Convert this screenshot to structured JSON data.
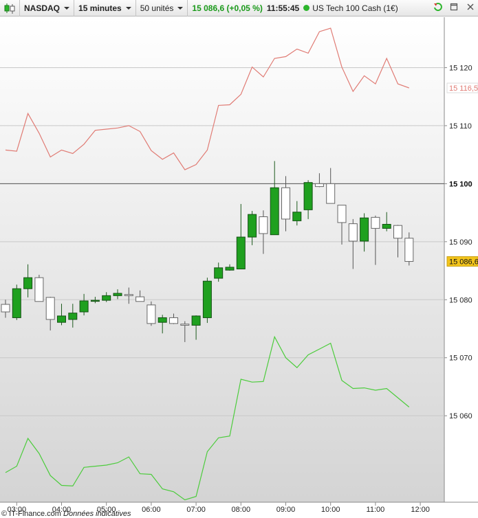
{
  "toolbar": {
    "symbol": "NASDAQ",
    "timeframe": "15 minutes",
    "units": "50 unités",
    "last_price": "15 086,6 (+0,05 %)",
    "time": "11:55:45",
    "instrument_name": "US Tech 100 Cash (1€)",
    "logo_icon": "candlestick-chart-icon",
    "refresh_icon": "refresh-icon",
    "restore_icon": "restore-window-icon",
    "close_icon": "close-icon"
  },
  "watermark": {
    "brand": "© IT-Finance.com",
    "note": "Données indicatives"
  },
  "colors": {
    "bull": "#1fa01f",
    "bear": "#ffffff",
    "upper_band": "#e07b74",
    "lower_band": "#4ccc3c",
    "last_price_bg": "#f2c41c",
    "last_upper_label": "#e07b74"
  },
  "chart_data": {
    "type": "candlestick",
    "x_tick_labels": [
      "03:00",
      "04:00",
      "05:00",
      "06:00",
      "07:00",
      "08:00",
      "09:00",
      "10:00",
      "11:00",
      "12:00"
    ],
    "y_tick_labels": [
      "15 120",
      "15 110",
      "15 100",
      "15 090",
      "15 080",
      "15 070",
      "15 060"
    ],
    "y_ticks": [
      15120,
      15110,
      15100,
      15090,
      15080,
      15070,
      15060
    ],
    "ylim": [
      15045.1,
      15128.7
    ],
    "reference_line": 15100,
    "reference_label": "15 100",
    "last_price": 15086.6,
    "last_price_label": "15 086,6",
    "upper_last": 15116.5,
    "upper_last_label": "15 116,5",
    "grid": true,
    "candles": [
      {
        "time": "02:45",
        "open": 15079.2,
        "high": 15080.0,
        "low": 15076.9,
        "close": 15077.9
      },
      {
        "time": "03:00",
        "open": 15076.9,
        "high": 15082.6,
        "low": 15076.5,
        "close": 15081.9
      },
      {
        "time": "03:15",
        "open": 15081.9,
        "high": 15086.1,
        "low": 15080.4,
        "close": 15083.8
      },
      {
        "time": "03:30",
        "open": 15083.8,
        "high": 15084.3,
        "low": 15079.7,
        "close": 15079.7
      },
      {
        "time": "03:45",
        "open": 15080.4,
        "high": 15080.5,
        "low": 15074.7,
        "close": 15076.6
      },
      {
        "time": "04:00",
        "open": 15076.1,
        "high": 15079.3,
        "low": 15075.6,
        "close": 15077.2
      },
      {
        "time": "04:15",
        "open": 15076.6,
        "high": 15079.3,
        "low": 15075.2,
        "close": 15077.7
      },
      {
        "time": "04:30",
        "open": 15077.9,
        "high": 15081.0,
        "low": 15077.3,
        "close": 15079.8
      },
      {
        "time": "04:45",
        "open": 15079.8,
        "high": 15080.5,
        "low": 15079.4,
        "close": 15079.9
      },
      {
        "time": "05:00",
        "open": 15079.9,
        "high": 15081.3,
        "low": 15079.6,
        "close": 15080.7
      },
      {
        "time": "05:15",
        "open": 15080.7,
        "high": 15081.8,
        "low": 15080.1,
        "close": 15081.1
      },
      {
        "time": "05:30",
        "open": 15080.9,
        "high": 15082.1,
        "low": 15079.3,
        "close": 15080.7
      },
      {
        "time": "05:45",
        "open": 15080.5,
        "high": 15081.6,
        "low": 15079.7,
        "close": 15079.7
      },
      {
        "time": "06:00",
        "open": 15079.1,
        "high": 15079.7,
        "low": 15075.5,
        "close": 15075.9
      },
      {
        "time": "06:15",
        "open": 15076.1,
        "high": 15077.4,
        "low": 15074.2,
        "close": 15076.9
      },
      {
        "time": "06:30",
        "open": 15076.9,
        "high": 15077.6,
        "low": 15075.8,
        "close": 15075.9
      },
      {
        "time": "06:45",
        "open": 15075.8,
        "high": 15076.3,
        "low": 15072.7,
        "close": 15075.6
      },
      {
        "time": "07:00",
        "open": 15075.6,
        "high": 15077.3,
        "low": 15073.1,
        "close": 15077.2
      },
      {
        "time": "07:15",
        "open": 15076.9,
        "high": 15083.8,
        "low": 15076.0,
        "close": 15083.2
      },
      {
        "time": "07:30",
        "open": 15083.7,
        "high": 15086.4,
        "low": 15083.1,
        "close": 15085.5
      },
      {
        "time": "07:45",
        "open": 15085.1,
        "high": 15086.1,
        "low": 15085.0,
        "close": 15085.6
      },
      {
        "time": "08:00",
        "open": 15085.3,
        "high": 15096.5,
        "low": 15085.3,
        "close": 15090.8
      },
      {
        "time": "08:15",
        "open": 15090.8,
        "high": 15095.3,
        "low": 15089.4,
        "close": 15094.7
      },
      {
        "time": "08:30",
        "open": 15094.3,
        "high": 15095.4,
        "low": 15087.9,
        "close": 15091.4
      },
      {
        "time": "08:45",
        "open": 15091.2,
        "high": 15103.9,
        "low": 15091.2,
        "close": 15099.3
      },
      {
        "time": "09:00",
        "open": 15099.3,
        "high": 15101.3,
        "low": 15091.8,
        "close": 15093.9
      },
      {
        "time": "09:15",
        "open": 15093.6,
        "high": 15097.0,
        "low": 15092.8,
        "close": 15095.1
      },
      {
        "time": "09:30",
        "open": 15095.5,
        "high": 15100.6,
        "low": 15093.9,
        "close": 15100.2
      },
      {
        "time": "09:45",
        "open": 15100.0,
        "high": 15101.8,
        "low": 15099.4,
        "close": 15099.5
      },
      {
        "time": "10:00",
        "open": 15100.0,
        "high": 15102.7,
        "low": 15098.7,
        "close": 15096.6
      },
      {
        "time": "10:15",
        "open": 15096.3,
        "high": 15096.3,
        "low": 15089.5,
        "close": 15093.3
      },
      {
        "time": "10:30",
        "open": 15093.1,
        "high": 15093.9,
        "low": 15085.3,
        "close": 15090.1
      },
      {
        "time": "10:45",
        "open": 15090.1,
        "high": 15094.9,
        "low": 15088.3,
        "close": 15094.1
      },
      {
        "time": "11:00",
        "open": 15094.2,
        "high": 15094.5,
        "low": 15086.0,
        "close": 15092.3
      },
      {
        "time": "11:15",
        "open": 15092.3,
        "high": 15095.1,
        "low": 15091.8,
        "close": 15093.0
      },
      {
        "time": "11:30",
        "open": 15092.8,
        "high": 15092.9,
        "low": 15087.3,
        "close": 15090.6
      },
      {
        "time": "11:45",
        "open": 15090.6,
        "high": 15091.6,
        "low": 15085.9,
        "close": 15086.6
      }
    ],
    "upper_band": [
      15105.8,
      15105.6,
      15112.1,
      15108.7,
      15104.6,
      15105.8,
      15105.2,
      15106.8,
      15109.2,
      15109.4,
      15109.6,
      15110.0,
      15109.0,
      15105.7,
      15104.2,
      15105.3,
      15102.4,
      15103.3,
      15105.8,
      15113.5,
      15113.6,
      15115.4,
      15120.1,
      15118.4,
      15121.6,
      15121.9,
      15123.2,
      15122.5,
      15126.2,
      15126.8,
      15120.1,
      15115.9,
      15118.6,
      15117.2,
      15121.6,
      15117.2,
      15116.5
    ],
    "lower_band": [
      15050.2,
      15051.3,
      15056.1,
      15053.5,
      15049.7,
      15048.0,
      15047.9,
      15051.1,
      15051.3,
      15051.5,
      15051.9,
      15052.9,
      15050.0,
      15049.9,
      15047.4,
      15046.9,
      15045.5,
      15046.1,
      15053.8,
      15056.2,
      15056.5,
      15066.3,
      15065.8,
      15065.9,
      15073.6,
      15070.0,
      15068.3,
      15070.5,
      15071.5,
      15072.5,
      15066.1,
      15064.7,
      15064.8,
      15064.4,
      15064.7,
      15063.1,
      15061.5
    ]
  }
}
